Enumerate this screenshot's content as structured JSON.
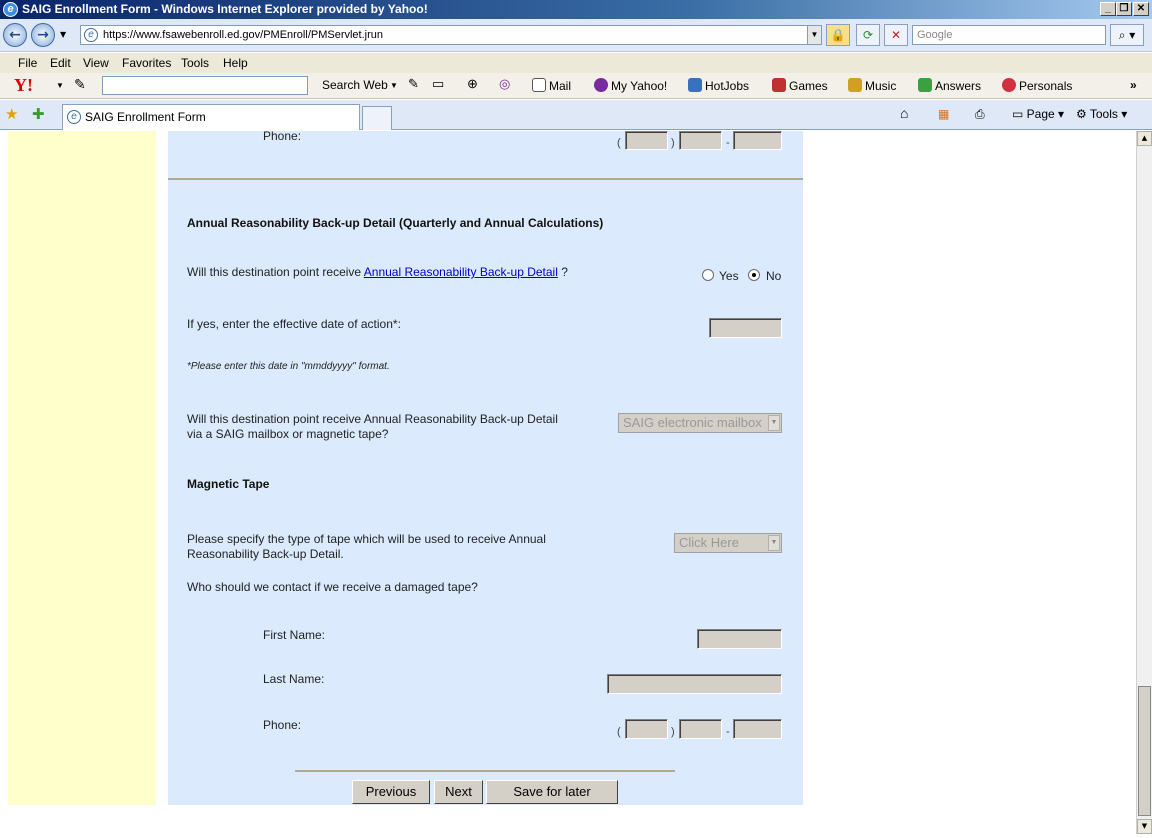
{
  "window": {
    "title": "SAIG Enrollment Form - Windows Internet Explorer provided by Yahoo!"
  },
  "address": {
    "url": "https://www.fsawebenroll.ed.gov/PMEnroll/PMServlet.jrun",
    "search_placeholder": "Google"
  },
  "menu": [
    "File",
    "Edit",
    "View",
    "Favorites",
    "Tools",
    "Help"
  ],
  "yahoo_toolbar": {
    "search_button": "Search Web",
    "mail": "Mail",
    "my_yahoo": "My Yahoo!",
    "hotjobs": "HotJobs",
    "games": "Games",
    "music": "Music",
    "answers": "Answers",
    "personals": "Personals"
  },
  "tab": {
    "title": "SAIG Enrollment Form"
  },
  "tab_tools": {
    "page": "Page",
    "tools": "Tools"
  },
  "form": {
    "phone_label_top": "Phone:",
    "section_title": "Annual Reasonability Back-up Detail (Quarterly and Annual Calculations)",
    "question1_prefix": "Will this destination point receive ",
    "question1_link": "Annual Reasonability Back-up Detail",
    "question1_suffix": " ?",
    "yes": "Yes",
    "no": "No",
    "effective_date_label": "If yes, enter the effective date of action*:",
    "date_note": "*Please enter this date in \"mmddyyyy\" format.",
    "delivery_question_line1": "Will this destination point receive Annual Reasonability Back-up Detail",
    "delivery_question_line2": "via a SAIG mailbox or magnetic tape?",
    "delivery_selected": "SAIG electronic mailbox",
    "tape_section_title": "Magnetic Tape",
    "tape_type_line1": "Please specify the type of tape which will be used to receive Annual",
    "tape_type_line2": "Reasonability Back-up Detail.",
    "tape_selected": "Click Here",
    "contact_question": "Who should we contact if we receive a damaged tape?",
    "first_name_label": "First Name:",
    "last_name_label": "Last Name:",
    "phone_label": "Phone:",
    "paren_open": "(",
    "paren_close": ")",
    "dash": "-",
    "btn_previous": "Previous",
    "btn_next": "Next",
    "btn_save": "Save for later"
  }
}
